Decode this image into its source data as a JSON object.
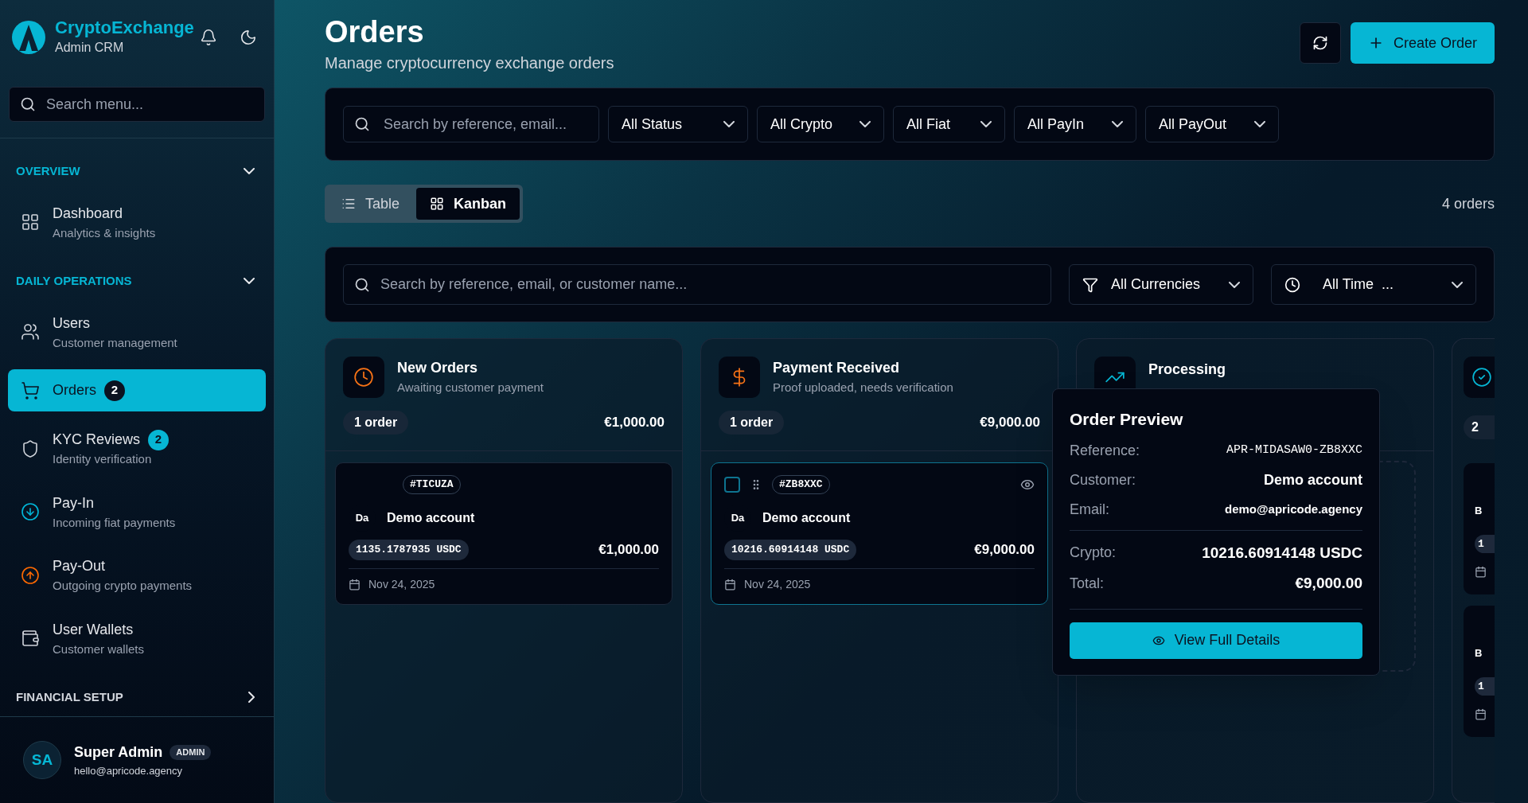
{
  "brand": {
    "name": "CryptoExchange",
    "subtitle": "Admin CRM"
  },
  "sidebar": {
    "search": {
      "placeholder": "Search menu..."
    },
    "sections": [
      {
        "title": "OVERVIEW",
        "expanded": true,
        "items": [
          {
            "label": "Dashboard",
            "subtitle": "Analytics & insights",
            "selected": false
          }
        ]
      },
      {
        "title": "DAILY OPERATIONS",
        "expanded": true,
        "items": [
          {
            "label": "Users",
            "subtitle": "Customer management",
            "selected": false
          },
          {
            "label": "Orders",
            "badge": "2",
            "selected": true
          },
          {
            "label": "KYC Reviews",
            "badge": "2",
            "subtitle": "Identity verification",
            "selected": false
          },
          {
            "label": "Pay-In",
            "subtitle": "Incoming fiat payments",
            "selected": false
          },
          {
            "label": "Pay-Out",
            "subtitle": "Outgoing crypto payments",
            "selected": false
          },
          {
            "label": "User Wallets",
            "subtitle": "Customer wallets",
            "selected": false
          }
        ]
      },
      {
        "title": "FINANCIAL SETUP",
        "expanded": false
      }
    ]
  },
  "user": {
    "initials": "SA",
    "name": "Super Admin",
    "role": "ADMIN",
    "email": "hello@apricode.agency"
  },
  "page": {
    "title": "Orders",
    "subtitle": "Manage cryptocurrency exchange orders"
  },
  "create_button": "Create Order",
  "filters": {
    "search": {
      "placeholder": "Search by reference, email..."
    },
    "dropdowns": [
      "All Status",
      "All Crypto",
      "All Fiat",
      "All PayIn",
      "All PayOut"
    ]
  },
  "view_tabs": [
    {
      "label": "Table",
      "selected": false
    },
    {
      "label": "Kanban",
      "selected": true
    }
  ],
  "order_count": "4 orders",
  "kanban_filters": {
    "search": {
      "placeholder": "Search by reference, email, or customer name..."
    },
    "currency": "All Currencies",
    "time": "All Time  ..."
  },
  "columns": [
    {
      "kind": "full",
      "color": "#f97316",
      "title": "New Orders",
      "subtitle": "Awaiting customer payment",
      "count": "1 order",
      "total": "€1,000.00",
      "cards": [
        {
          "ref": "#TICUZA",
          "initials": "Da",
          "customer": "Demo account",
          "crypto": "1135.1787935 USDC",
          "amount": "€1,000.00",
          "date": "Nov 24, 2025",
          "highlighted": false
        }
      ]
    },
    {
      "kind": "full",
      "color": "#f97316",
      "title": "Payment Received",
      "subtitle": "Proof uploaded, needs verification",
      "count": "1 order",
      "total": "€9,000.00",
      "cards": [
        {
          "ref": "#ZB8XXC",
          "initials": "Da",
          "customer": "Demo account",
          "crypto": "10216.60914148 USDC",
          "amount": "€9,000.00",
          "date": "Nov 24, 2025",
          "highlighted": true
        }
      ]
    },
    {
      "kind": "full",
      "color": "#06b6d4",
      "title": "Processing"
    },
    {
      "kind": "partial",
      "color": "#06b6d4",
      "count": "2",
      "cards": [
        {
          "initials": "B",
          "crypto": "1"
        },
        {
          "initials": "B",
          "crypto": "1"
        }
      ]
    }
  ],
  "preview": {
    "title": "Order Preview",
    "groups": [
      [
        {
          "kind": "mono",
          "label": "Reference:",
          "value": "APR-MIDASAW0-ZB8XXC"
        },
        {
          "kind": "bold",
          "label": "Customer:",
          "value": "Demo account"
        },
        {
          "kind": "small",
          "label": "Email:",
          "value": "demo@apricode.agency"
        }
      ],
      [
        {
          "kind": "large",
          "label": "Crypto:",
          "value": "10216.60914148 USDC"
        },
        {
          "kind": "bold-large",
          "label": "Total:",
          "value": "€9,000.00"
        }
      ]
    ],
    "button": "View Full Details"
  }
}
